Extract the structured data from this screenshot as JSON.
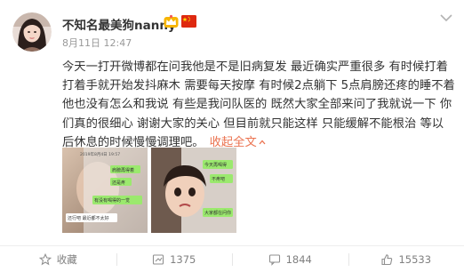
{
  "user": {
    "name": "不知名最美狗nanny",
    "post_time": "8月11日 12:47"
  },
  "post": {
    "text": "今天一打开微博都在问我他是不是旧病复发 最近确实严重很多 有时候打着打着手就开始发抖麻木 需要每天按摩 有时候2点躺下 5点肩膀还疼的睡不着 他也没有怎么和我说 有些是我问队医的 既然大家全部来问了我就说一下 你们真的很细心 谢谢大家的关心 但目前就只能这样 只能缓解不能根治 等以后休息的时候慢慢调理吧。",
    "collapse_label": "收起全文"
  },
  "images": [
    {
      "chat_date": "2019年8月4日 19:57",
      "bubbles": [
        "肩膀再得着",
        "还是疼",
        "有没有喝得的一觉",
        "还行吧 最近都不太好"
      ]
    },
    {
      "bubbles": [
        "今天再喝得",
        "不疼吧",
        "大家都在问你"
      ]
    }
  ],
  "actions": {
    "favorite_label": "收藏",
    "repost_count": "1375",
    "comment_count": "1844",
    "like_count": "15533"
  },
  "colors": {
    "accent": "#eb7350",
    "text": "#333333",
    "muted": "#999999",
    "chat_green": "#9be96e"
  }
}
